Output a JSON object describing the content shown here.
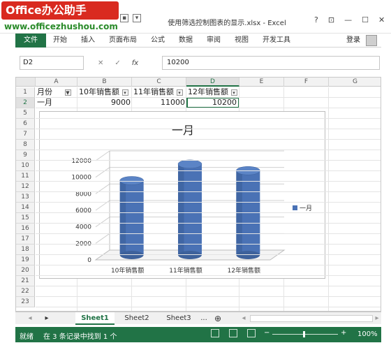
{
  "watermark": {
    "brand": "Office办公助手",
    "url": "www.officezhushou.com"
  },
  "window": {
    "title": "使用筛选控制图表的显示.xlsx - Excel",
    "help": "?",
    "minimize": "—",
    "maximize": "☐",
    "close": "✕"
  },
  "ribbon": {
    "tabs": [
      "文件",
      "开始",
      "插入",
      "页面布局",
      "公式",
      "数据",
      "审阅",
      "视图",
      "开发工具"
    ],
    "login": "登录"
  },
  "formula_bar": {
    "name_box": "D2",
    "cancel": "✕",
    "enter": "✓",
    "fx": "fx",
    "value": "10200"
  },
  "columns": [
    "A",
    "B",
    "C",
    "D",
    "E",
    "F",
    "G"
  ],
  "rows": [
    "1",
    "2",
    "5",
    "6",
    "7",
    "8",
    "9",
    "10",
    "11",
    "12",
    "13",
    "14",
    "15",
    "16",
    "17",
    "18",
    "19",
    "20",
    "21",
    "22",
    "23"
  ],
  "cells": {
    "A1": "月份",
    "B1": "10年销售额",
    "C1": "11年销售额",
    "D1": "12年销售额",
    "A2": "一月",
    "B2": "9000",
    "C2": "11000",
    "D2": "10200"
  },
  "chart_data": {
    "type": "bar",
    "title": "一月",
    "categories": [
      "10年销售额",
      "11年销售额",
      "12年销售额"
    ],
    "series": [
      {
        "name": "一月",
        "values": [
          9000,
          11000,
          10200
        ]
      }
    ],
    "ylim": [
      0,
      12000
    ],
    "yticks": [
      "0",
      "2000",
      "4000",
      "6000",
      "8000",
      "10000",
      "12000"
    ],
    "grid": true,
    "legend": "right",
    "color": "#4a72b5"
  },
  "sheet_tabs": [
    "Sheet1",
    "Sheet2",
    "Sheet3",
    "..."
  ],
  "status": {
    "ready": "就绪",
    "found": "在 3 条记录中找到 1 个",
    "zoom": "100%"
  }
}
